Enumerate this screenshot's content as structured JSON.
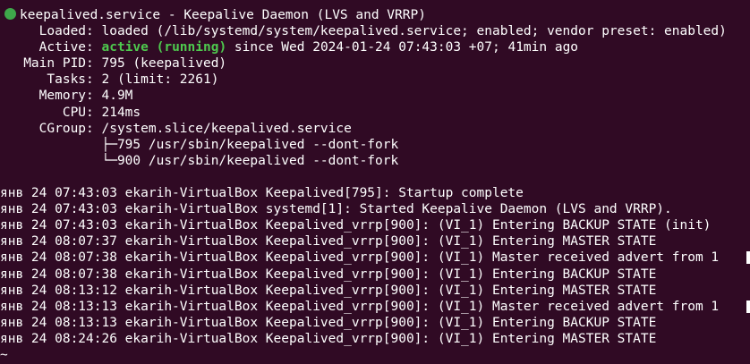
{
  "colors": {
    "background": "#300a24",
    "text": "#ffffff",
    "active": "#4ec94e",
    "dot": "#3ea64a"
  },
  "header": {
    "status_icon": "green-dot-icon",
    "title": "keepalived.service - Keepalive Daemon (LVS and VRRP)"
  },
  "status": {
    "loaded": "     Loaded: loaded (/lib/systemd/system/keepalived.service; enabled; vendor preset: enabled)",
    "active_prefix": "     Active: ",
    "active_state": "active (running)",
    "active_suffix": " since Wed 2024-01-24 07:43:03 +07; 41min ago",
    "main_pid": "   Main PID: 795 (keepalived)",
    "tasks": "      Tasks: 2 (limit: 2261)",
    "memory": "     Memory: 4.9M",
    "cpu": "        CPU: 214ms",
    "cgroup": "     CGroup: /system.slice/keepalived.service",
    "cgroup_children": [
      "             ├─795 /usr/sbin/keepalived --dont-fork",
      "             └─900 /usr/sbin/keepalived --dont-fork"
    ]
  },
  "log": [
    "янв 24 07:43:03 ekarih-VirtualBox Keepalived[795]: Startup complete",
    "янв 24 07:43:03 ekarih-VirtualBox systemd[1]: Started Keepalive Daemon (LVS and VRRP).",
    "янв 24 07:43:03 ekarih-VirtualBox Keepalived_vrrp[900]: (VI_1) Entering BACKUP STATE (init)",
    "янв 24 08:07:37 ekarih-VirtualBox Keepalived_vrrp[900]: (VI_1) Entering MASTER STATE",
    "янв 24 08:07:38 ekarih-VirtualBox Keepalived_vrrp[900]: (VI_1) Master received advert from 1",
    "янв 24 08:07:38 ekarih-VirtualBox Keepalived_vrrp[900]: (VI_1) Entering BACKUP STATE",
    "янв 24 08:13:12 ekarih-VirtualBox Keepalived_vrrp[900]: (VI_1) Entering MASTER STATE",
    "янв 24 08:13:13 ekarih-VirtualBox Keepalived_vrrp[900]: (VI_1) Master received advert from 1",
    "янв 24 08:13:13 ekarih-VirtualBox Keepalived_vrrp[900]: (VI_1) Entering BACKUP STATE",
    "янв 24 08:24:26 ekarih-VirtualBox Keepalived_vrrp[900]: (VI_1) Entering MASTER STATE"
  ],
  "prompt": "~"
}
